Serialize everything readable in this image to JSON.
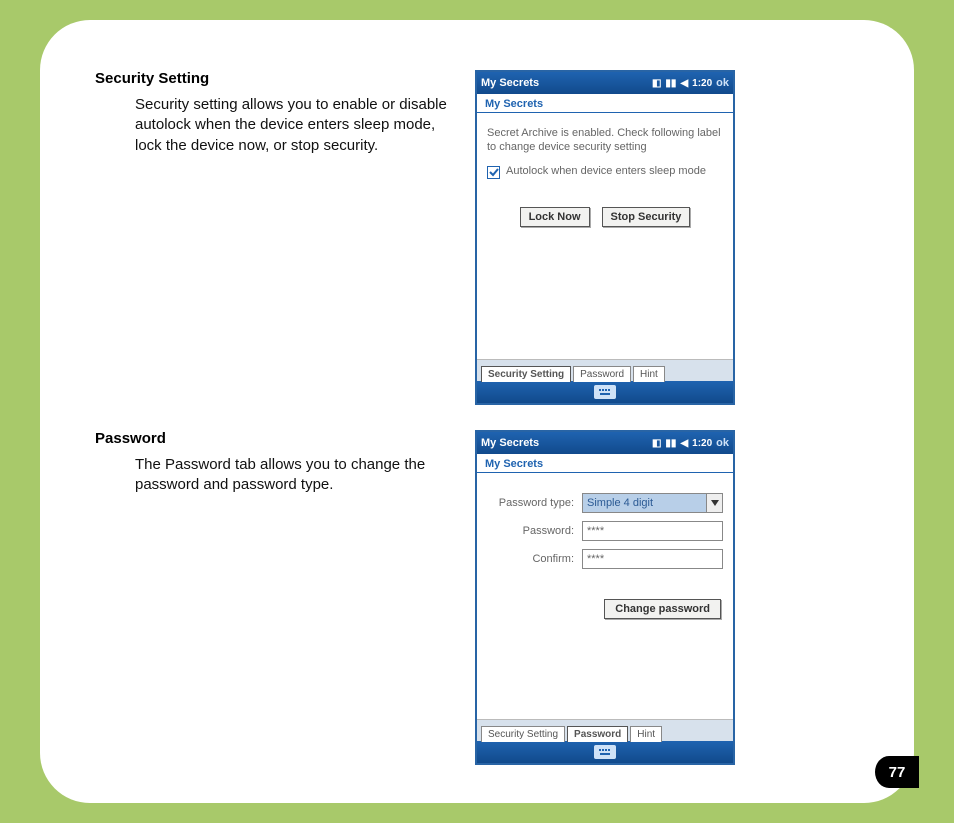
{
  "page_number": "77",
  "sections": {
    "security": {
      "heading": "Security Setting",
      "desc": "Security setting allows you to enable or disable autolock when the device enters sleep mode, lock the device now, or stop security."
    },
    "password": {
      "heading": "Password",
      "desc": "The Password tab allows you to change the password and password type."
    }
  },
  "device_common": {
    "app_title": "My Secrets",
    "subtitle": "My Secrets",
    "status_time": "1:20",
    "ok": "ok",
    "tabs": {
      "security": "Security Setting",
      "password": "Password",
      "hint": "Hint"
    }
  },
  "screen1": {
    "body_text": "Secret Archive is enabled. Check following label to change device security setting",
    "checkbox_label": "Autolock when device enters sleep mode",
    "btn_lock": "Lock Now",
    "btn_stop": "Stop Security",
    "active_tab": "Security Setting"
  },
  "screen2": {
    "label_type": "Password type:",
    "type_value": "Simple 4 digit",
    "label_pwd": "Password:",
    "pwd_value": "****",
    "label_confirm": "Confirm:",
    "confirm_value": "****",
    "btn_change": "Change password",
    "active_tab": "Password"
  }
}
